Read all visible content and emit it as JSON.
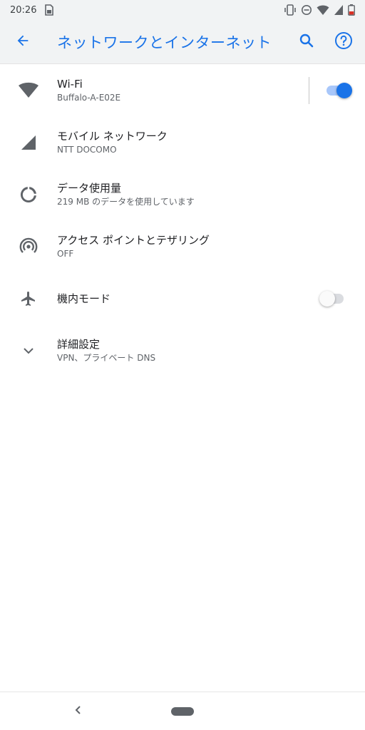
{
  "status_bar": {
    "time": "20:26"
  },
  "app_bar": {
    "title": "ネットワークとインターネット",
    "back_icon": "arrow-back-icon",
    "search_icon": "search-icon",
    "help_icon": "help-icon"
  },
  "items": [
    {
      "title": "Wi-Fi",
      "subtitle": "Buffalo-A-E02E",
      "icon": "wifi-icon",
      "toggle": true
    },
    {
      "title": "モバイル ネットワーク",
      "subtitle": "NTT DOCOMO",
      "icon": "cellular-signal-icon"
    },
    {
      "title": "データ使用量",
      "subtitle": "219 MB のデータを使用しています",
      "icon": "data-usage-icon"
    },
    {
      "title": "アクセス ポイントとテザリング",
      "subtitle": "OFF",
      "icon": "hotspot-icon"
    },
    {
      "title": "機内モード",
      "icon": "airplane-icon",
      "toggle": false
    },
    {
      "title": "詳細設定",
      "subtitle": "VPN、プライベート DNS",
      "icon": "chevron-down-icon"
    }
  ],
  "colors": {
    "accent": "#1a73e8",
    "icon": "#5f6368"
  }
}
